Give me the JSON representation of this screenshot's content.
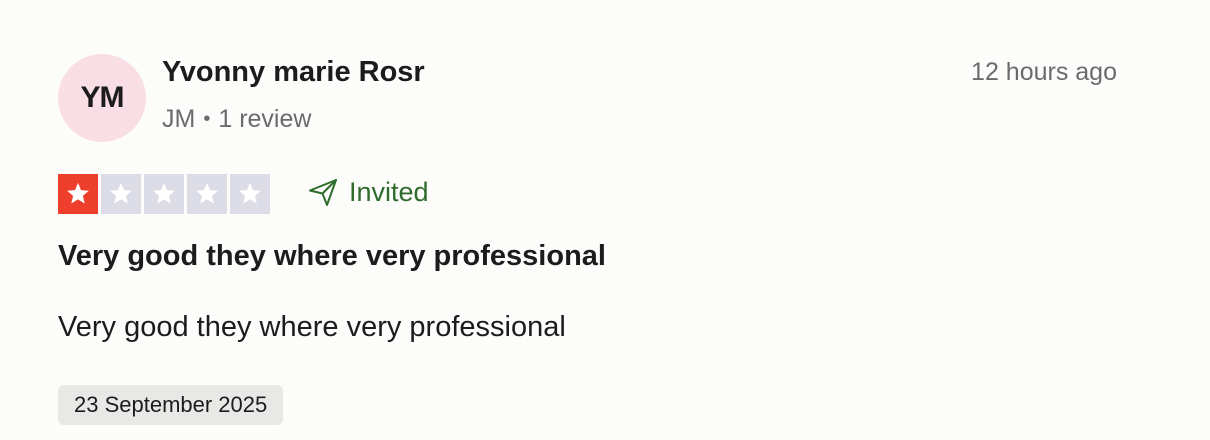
{
  "reviewer": {
    "initials": "YM",
    "name": "Yvonny marie Rosr",
    "country": "JM",
    "review_count": "1 review"
  },
  "timestamp": "12 hours ago",
  "rating": {
    "value": 1,
    "max": 5,
    "filled_color": "#ee3e2c",
    "empty_color": "#dcdce6"
  },
  "invited_label": "Invited",
  "review": {
    "title": "Very good they where very professional",
    "body": "Very good they where very professional",
    "date": "23 September 2025"
  },
  "colors": {
    "avatar_bg": "#f9dee6",
    "invited": "#2e6c2b"
  },
  "icons": {
    "star": "star-icon",
    "invited": "paper-plane-icon"
  }
}
